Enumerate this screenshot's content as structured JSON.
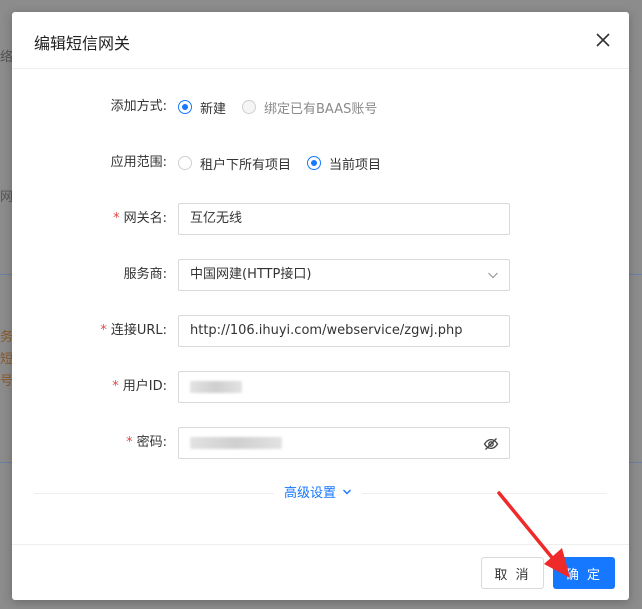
{
  "background": {
    "hints": [
      "络",
      "网",
      "务",
      "短",
      "号,"
    ]
  },
  "dialog": {
    "title": "编辑短信网关",
    "close_icon": "close-icon"
  },
  "form": {
    "add_method": {
      "label": "添加方式:",
      "options": [
        {
          "label": "新建",
          "selected": true,
          "disabled": false
        },
        {
          "label": "绑定已有BAAS账号",
          "selected": false,
          "disabled": true
        }
      ]
    },
    "scope": {
      "label": "应用范围:",
      "options": [
        {
          "label": "租户下所有项目",
          "selected": false
        },
        {
          "label": "当前项目",
          "selected": true
        }
      ]
    },
    "gateway_name": {
      "label": "网关名:",
      "required": true,
      "value": "互亿无线"
    },
    "provider": {
      "label": "服务商:",
      "value": "中国网建(HTTP接口)"
    },
    "url": {
      "label": "连接URL:",
      "required": true,
      "value": "http://106.ihuyi.com/webservice/zgwj.php"
    },
    "user_id": {
      "label": "用户ID:",
      "required": true
    },
    "password": {
      "label": "密码:",
      "required": true
    },
    "advanced_label": "高级设置"
  },
  "footer": {
    "cancel_label": "取 消",
    "ok_label": "确 定"
  },
  "colors": {
    "primary": "#1677ff",
    "required": "#e54545",
    "annotation": "#ee2a2a"
  }
}
